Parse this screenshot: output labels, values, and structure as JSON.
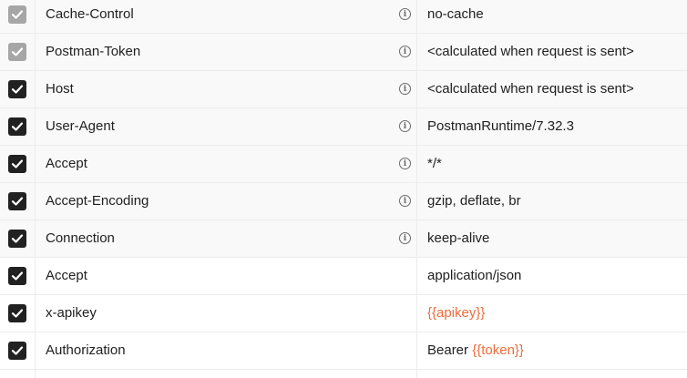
{
  "colors": {
    "accent": "#f26b3a",
    "checkbox_checked": "#212121",
    "checkbox_disabled": "#a6a6a6"
  },
  "headers": [
    {
      "key": "Cache-Control",
      "value": "no-cache",
      "auto": true,
      "checked": true,
      "info": true
    },
    {
      "key": "Postman-Token",
      "value": "<calculated when request is sent>",
      "auto": true,
      "checked": true,
      "info": true
    },
    {
      "key": "Host",
      "value": "<calculated when request is sent>",
      "auto": true,
      "checked": true,
      "info": true
    },
    {
      "key": "User-Agent",
      "value": "PostmanRuntime/7.32.3",
      "auto": true,
      "checked": true,
      "info": true
    },
    {
      "key": "Accept",
      "value": "*/*",
      "auto": true,
      "checked": true,
      "info": true
    },
    {
      "key": "Accept-Encoding",
      "value": "gzip, deflate, br",
      "auto": true,
      "checked": true,
      "info": true
    },
    {
      "key": "Connection",
      "value": "keep-alive",
      "auto": true,
      "checked": true,
      "info": true
    },
    {
      "key": "Accept",
      "value": "application/json",
      "auto": false,
      "checked": true,
      "info": false
    },
    {
      "key": "x-apikey",
      "value_var": "{{apikey}}",
      "auto": false,
      "checked": true,
      "info": false
    },
    {
      "key": "Authorization",
      "value_prefix": "Bearer ",
      "value_var": "{{token}}",
      "auto": false,
      "checked": true,
      "info": false
    }
  ],
  "icons": {
    "checkbox": "checkmark-icon",
    "info": "info-icon"
  },
  "info_glyph": "i"
}
